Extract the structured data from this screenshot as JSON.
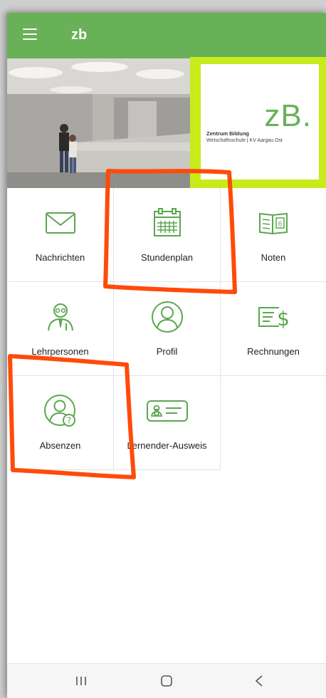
{
  "app": {
    "title": "zb"
  },
  "logo": {
    "mark": "zB.",
    "line1": "Zentrum Bildung",
    "line2": "Wirtschaftsschule | KV Aargau Ost"
  },
  "tiles": [
    {
      "label": "Nachrichten",
      "icon": "envelope-icon"
    },
    {
      "label": "Stundenplan",
      "icon": "calendar-icon"
    },
    {
      "label": "Noten",
      "icon": "notebook-icon"
    },
    {
      "label": "Lehrpersonen",
      "icon": "teacher-icon"
    },
    {
      "label": "Profil",
      "icon": "user-circle-icon"
    },
    {
      "label": "Rechnungen",
      "icon": "invoice-icon"
    },
    {
      "label": "Absenzen",
      "icon": "user-question-icon"
    },
    {
      "label": "Lernender-Ausweis",
      "icon": "id-card-icon"
    }
  ],
  "colors": {
    "appbar": "#68b157",
    "icon_green": "#5aa74e",
    "logo_frame": "#c7eb1b",
    "marker": "#ff4a0a"
  }
}
